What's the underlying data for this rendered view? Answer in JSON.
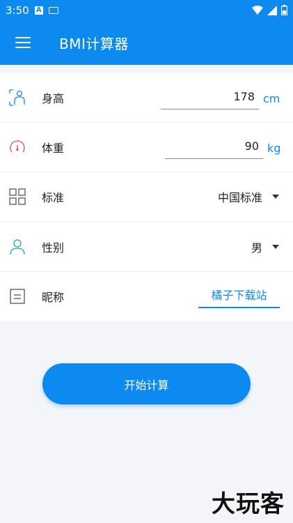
{
  "status_bar": {
    "time": "3:50"
  },
  "app_bar": {
    "title": "BMI计算器"
  },
  "form": {
    "height": {
      "label": "身高",
      "value": "178",
      "unit": "cm"
    },
    "weight": {
      "label": "体重",
      "value": "90",
      "unit": "kg"
    },
    "standard": {
      "label": "标准",
      "value": "中国标准"
    },
    "gender": {
      "label": "性别",
      "value": "男"
    },
    "nickname": {
      "label": "昵称",
      "value": "橘子下载站"
    }
  },
  "start_button": {
    "label": "开始计算"
  },
  "watermark": {
    "text": "大玩客"
  },
  "colors": {
    "primary": "#0d8af0",
    "weight_icon": "#e24a5f",
    "gender_icon": "#1aa89a"
  }
}
